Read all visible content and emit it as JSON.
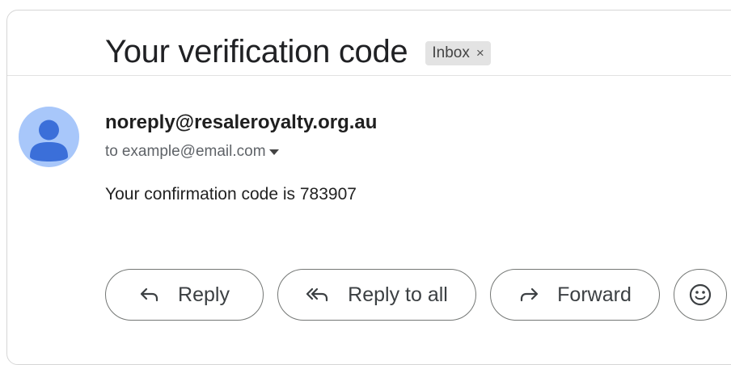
{
  "subject": "Your verification code",
  "label": {
    "text": "Inbox",
    "close": "×"
  },
  "sender": "noreply@resaleroyalty.org.au",
  "recipient": {
    "prefix": "to",
    "address": "example@email.com"
  },
  "body": "Your confirmation code is 783907",
  "actions": {
    "reply": "Reply",
    "reply_all": "Reply to all",
    "forward": "Forward"
  },
  "icons": {
    "avatar": "person-icon",
    "reply": "reply-arrow-icon",
    "reply_all": "reply-all-arrow-icon",
    "forward": "forward-arrow-icon",
    "emoji": "smiley-icon",
    "recipient_details": "chevron-down-icon"
  },
  "colors": {
    "avatar_bg": "#a8c7fa",
    "avatar_fg": "#3b6fd9"
  }
}
